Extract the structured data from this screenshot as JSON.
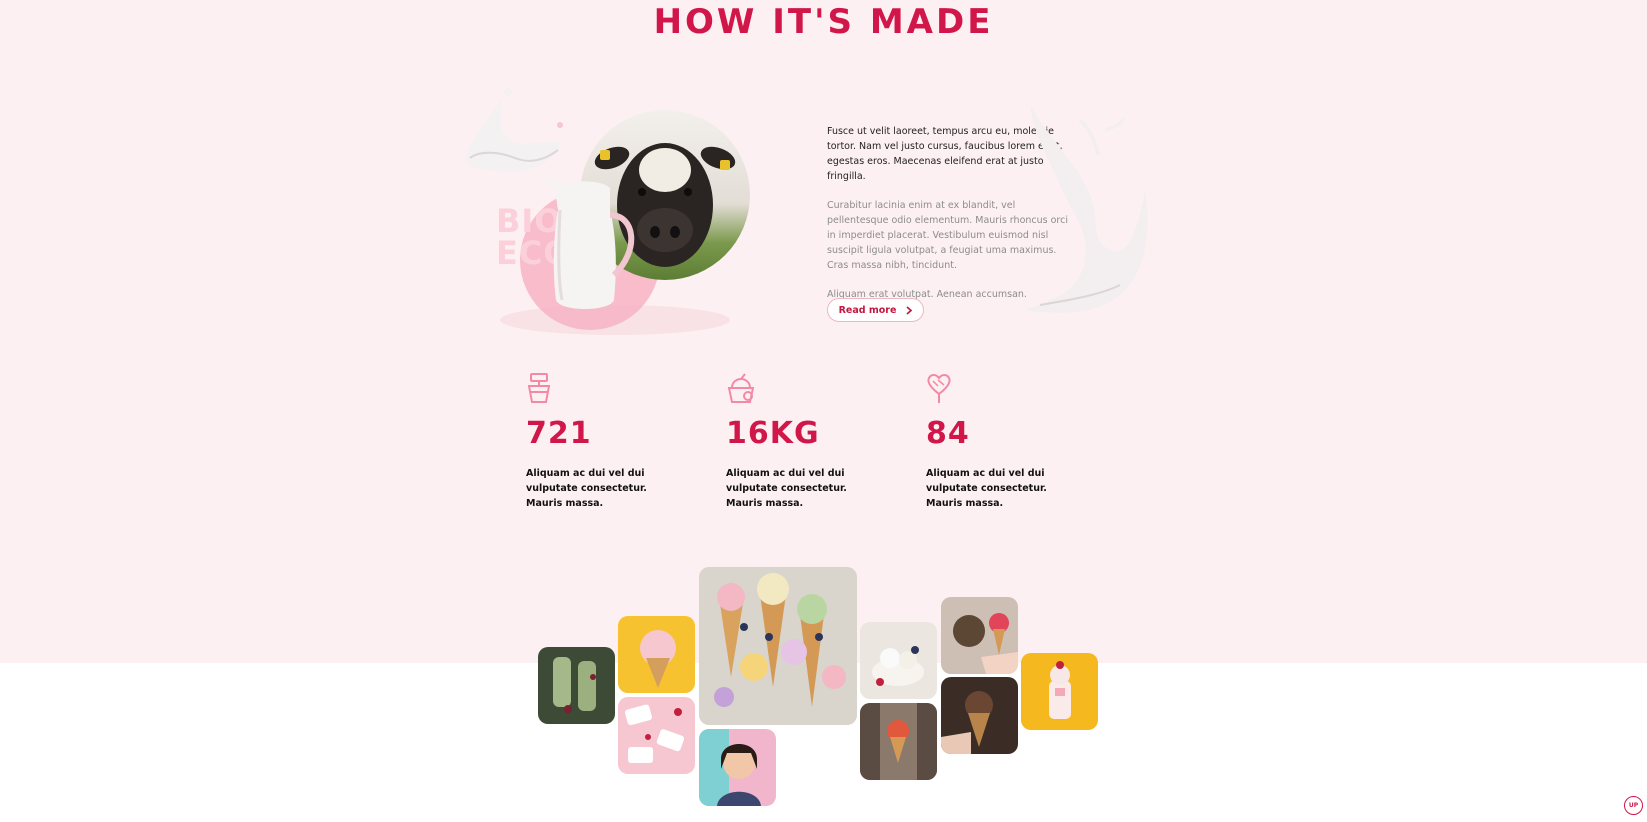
{
  "section": {
    "title": "HOW IT'S MADE"
  },
  "illustration": {
    "badge_line1": "BIO",
    "badge_line2": "ECO"
  },
  "content": {
    "paragraph1": "Fusce ut velit laoreet, tempus arcu eu, molestie tortor. Nam vel justo cursus, faucibus lorem eget, egestas eros. Maecenas eleifend erat at justo fringilla.",
    "paragraph2": "Curabitur lacinia enim at ex blandit, vel pellentesque odio elementum. Mauris rhoncus orci in imperdiet placerat. Vestibulum euismod nisl suscipit ligula volutpat, a feugiat uma maximus. Cras massa nibh, tincidunt.",
    "paragraph3": "Aliquam erat volutpat. Aenean accumsan.",
    "read_more_label": "Read more",
    "read_more_icon": "chevron-right-icon"
  },
  "stats": [
    {
      "icon": "cup-icon",
      "value": "721",
      "description": "Aliquam ac dui vel dui vulputate consectetur. Mauris massa."
    },
    {
      "icon": "dessert-bowl-icon",
      "value": "16KG",
      "description": "Aliquam ac dui vel dui vulputate consectetur. Mauris massa."
    },
    {
      "icon": "heart-popsicle-icon",
      "value": "84",
      "description": "Aliquam ac dui vel dui vulputate consectetur. Mauris massa."
    }
  ],
  "scroll_top": {
    "label": "UP"
  },
  "colors": {
    "accent": "#d1174a",
    "band": "#fdf0f2",
    "yellow": "#f7c230",
    "pink_tile": "#f7c6d2"
  }
}
